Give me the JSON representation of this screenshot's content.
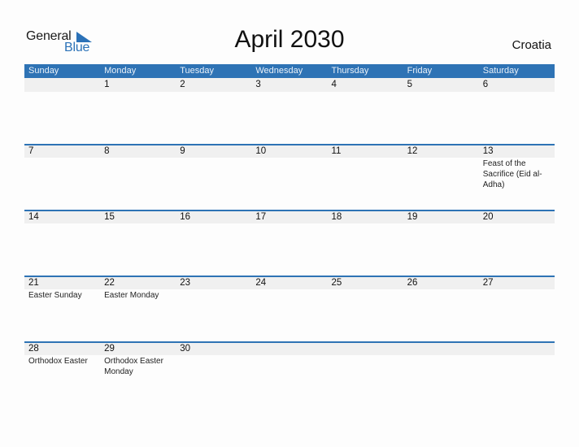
{
  "logo": {
    "general": "General",
    "blue": "Blue"
  },
  "title": "April 2030",
  "country": "Croatia",
  "colors": {
    "header_bg": "#2e73b5",
    "accent": "#2b72b8",
    "strip_bg": "#f0f0f0"
  },
  "weekdays": [
    "Sunday",
    "Monday",
    "Tuesday",
    "Wednesday",
    "Thursday",
    "Friday",
    "Saturday"
  ],
  "weeks": [
    [
      {
        "day": "",
        "event": ""
      },
      {
        "day": "1",
        "event": ""
      },
      {
        "day": "2",
        "event": ""
      },
      {
        "day": "3",
        "event": ""
      },
      {
        "day": "4",
        "event": ""
      },
      {
        "day": "5",
        "event": ""
      },
      {
        "day": "6",
        "event": ""
      }
    ],
    [
      {
        "day": "7",
        "event": ""
      },
      {
        "day": "8",
        "event": ""
      },
      {
        "day": "9",
        "event": ""
      },
      {
        "day": "10",
        "event": ""
      },
      {
        "day": "11",
        "event": ""
      },
      {
        "day": "12",
        "event": ""
      },
      {
        "day": "13",
        "event": "Feast of the Sacrifice (Eid al-Adha)"
      }
    ],
    [
      {
        "day": "14",
        "event": ""
      },
      {
        "day": "15",
        "event": ""
      },
      {
        "day": "16",
        "event": ""
      },
      {
        "day": "17",
        "event": ""
      },
      {
        "day": "18",
        "event": ""
      },
      {
        "day": "19",
        "event": ""
      },
      {
        "day": "20",
        "event": ""
      }
    ],
    [
      {
        "day": "21",
        "event": "Easter Sunday"
      },
      {
        "day": "22",
        "event": "Easter Monday"
      },
      {
        "day": "23",
        "event": ""
      },
      {
        "day": "24",
        "event": ""
      },
      {
        "day": "25",
        "event": ""
      },
      {
        "day": "26",
        "event": ""
      },
      {
        "day": "27",
        "event": ""
      }
    ],
    [
      {
        "day": "28",
        "event": "Orthodox Easter"
      },
      {
        "day": "29",
        "event": "Orthodox Easter Monday"
      },
      {
        "day": "30",
        "event": ""
      },
      {
        "day": "",
        "event": ""
      },
      {
        "day": "",
        "event": ""
      },
      {
        "day": "",
        "event": ""
      },
      {
        "day": "",
        "event": ""
      }
    ]
  ]
}
